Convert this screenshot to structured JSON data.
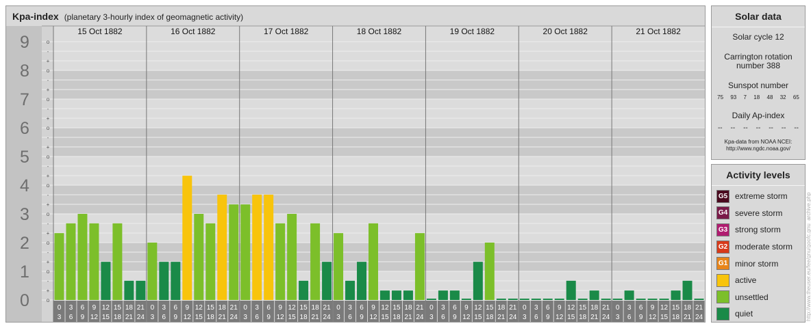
{
  "header": {
    "title": "Kpa-index",
    "subtitle": "(planetary 3-hourly index of geomagnetic activity)"
  },
  "chart_data": {
    "type": "bar",
    "title": "Kpa-index",
    "subtitle": "(planetary 3-hourly index of geomagnetic activity)",
    "y_tick_labels": [
      "0",
      "1",
      "2",
      "3",
      "4",
      "5",
      "6",
      "7",
      "8",
      "9"
    ],
    "y_sub_labels": [
      "o",
      "+",
      "-",
      "o",
      "+",
      "-",
      "o",
      "+",
      "-",
      "o",
      "+",
      "-",
      "o",
      "+",
      "-",
      "o",
      "+",
      "-",
      "o",
      "+",
      "-",
      "o",
      "+",
      "-",
      "o",
      "+",
      "-",
      "o"
    ],
    "ylim": [
      0,
      9
    ],
    "days": [
      "15 Oct 1882",
      "16 Oct 1882",
      "17 Oct 1882",
      "18 Oct 1882",
      "19 Oct 1882",
      "20 Oct 1882",
      "21 Oct 1882"
    ],
    "interval_start": [
      "0",
      "3",
      "6",
      "9",
      "12",
      "15",
      "18",
      "21"
    ],
    "interval_end": [
      "3",
      "6",
      "9",
      "12",
      "15",
      "18",
      "21",
      "24"
    ],
    "values": [
      [
        2.33,
        2.67,
        3,
        2.67,
        1.33,
        2.67,
        0.67,
        0.67
      ],
      [
        2,
        1.33,
        1.33,
        4.33,
        3,
        2.67,
        3.67,
        3.33
      ],
      [
        3.33,
        3.67,
        3.67,
        2.67,
        3,
        0.67,
        2.67,
        1.33
      ],
      [
        2.33,
        0.67,
        1.33,
        2.67,
        0.33,
        0.33,
        0.33,
        2.33
      ],
      [
        0,
        0.33,
        0.33,
        0,
        1.33,
        2,
        0,
        0
      ],
      [
        0,
        0,
        0,
        0,
        0.67,
        0,
        0.33,
        0
      ],
      [
        0,
        0.33,
        0,
        0,
        0,
        0.33,
        0.67,
        0
      ]
    ],
    "colors": {
      "quiet": "#1a8a48",
      "unsettled": "#7cbf2a",
      "active": "#f8c40c"
    }
  },
  "solar": {
    "title": "Solar data",
    "cycle": "Solar cycle 12",
    "carrington_1": "Carrington rotation",
    "carrington_2": "number 388",
    "sunspot_label": "Sunspot number",
    "sunspots": [
      "75",
      "93",
      "7",
      "18",
      "48",
      "32",
      "65"
    ],
    "ap_label": "Daily Ap-index",
    "ap_values": [
      "--",
      "--",
      "--",
      "--",
      "--",
      "--",
      "--"
    ],
    "source_1": "Kpa-data from NOAA NCEI:",
    "source_2": "http://www.ngdc.noaa.gov/"
  },
  "levels": {
    "title": "Activity levels",
    "items": [
      {
        "code": "G5",
        "label": "extreme storm",
        "color": "#4a0a1e"
      },
      {
        "code": "G4",
        "label": "severe storm",
        "color": "#7a1a48"
      },
      {
        "code": "G3",
        "label": "strong storm",
        "color": "#b01c70"
      },
      {
        "code": "G2",
        "label": "moderate storm",
        "color": "#d83a1a"
      },
      {
        "code": "G1",
        "label": "minor storm",
        "color": "#e8851a"
      },
      {
        "code": "",
        "label": "active",
        "color": "#f8c40c"
      },
      {
        "code": "",
        "label": "unsettled",
        "color": "#7cbf2a"
      },
      {
        "code": "",
        "label": "quiet",
        "color": "#1a8a48"
      }
    ]
  },
  "credit": "http://www.theuser.eu/fee/gnu/goofc.gnu_archive.php"
}
